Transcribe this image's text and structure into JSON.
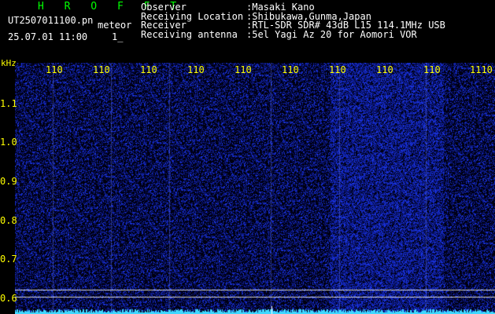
{
  "header": {
    "program": "H R O F F T",
    "filename": "UT2507011100.pn",
    "tag": "meteor",
    "datetime": "25.07.01 11:00",
    "counter": "1_"
  },
  "info": {
    "rows": [
      {
        "label": "Observer",
        "value": ":Masaki Kano"
      },
      {
        "label": "Receiving Location",
        "value": ":Shibukawa,Gunma,Japan"
      },
      {
        "label": "Receiver",
        "value": ":RTL-SDR SDR# 43dB L15 114.1MHz USB"
      },
      {
        "label": "Receiving antenna",
        "value": ":5el Yagi Az 20 for Aomori VOR"
      }
    ]
  },
  "axis": {
    "unit_label": "kHz",
    "x_ticks": [
      "110",
      "110",
      "110",
      "110",
      "110",
      "110",
      "110",
      "110",
      "110",
      "1110"
    ],
    "y_ticks": [
      "1.1",
      "1.0",
      "0.9",
      "0.8",
      "0.7",
      "0.6"
    ]
  },
  "colors": {
    "label": "#ffff00",
    "text": "#ffffff",
    "title": "#00ff00",
    "noise": "#1a2aa8",
    "signal": "#3fd8ff"
  }
}
